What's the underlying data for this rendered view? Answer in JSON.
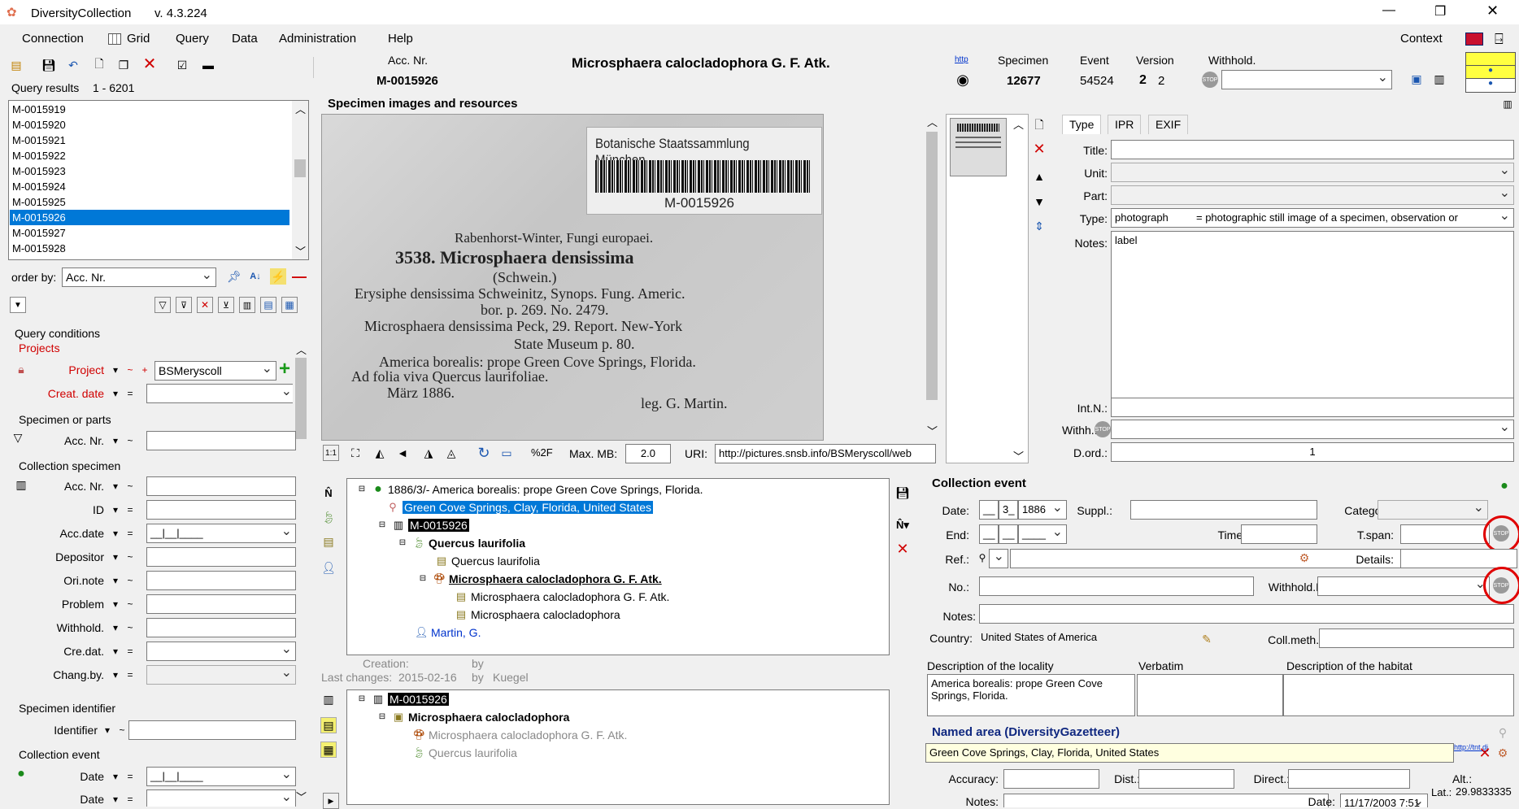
{
  "app": {
    "title": "DiversityCollection",
    "version": "v. 4.3.224"
  },
  "window_controls": {
    "minimize": "—",
    "restore": "❐",
    "close": "✕"
  },
  "menu": [
    "Connection",
    "Grid",
    "Query",
    "Data",
    "Administration",
    "Help"
  ],
  "context_label": "Context",
  "header": {
    "acc_nr_label": "Acc. Nr.",
    "acc_nr_value": "M-0015926",
    "taxon_title": "Microsphaera calocladophora G. F. Atk.",
    "http_label": "http",
    "specimen_label": "Specimen",
    "specimen_value": "12677",
    "event_label": "Event",
    "event_value": "54524",
    "version_label": "Version",
    "version_value_a": "2",
    "version_value_b": "2",
    "withhold_label": "Withhold."
  },
  "query_results": {
    "label": "Query results",
    "range": "1 - 6201",
    "items": [
      "M-0015919",
      "M-0015920",
      "M-0015921",
      "M-0015922",
      "M-0015923",
      "M-0015924",
      "M-0015925",
      "M-0015926",
      "M-0015927",
      "M-0015928"
    ],
    "selected_index": 7
  },
  "order_by": {
    "label": "order by:",
    "value": "Acc. Nr."
  },
  "query_conditions": {
    "title": "Query conditions",
    "projects_title": "Projects",
    "project_label": "Project",
    "project_value": "BSMeryscoll",
    "creat_date_label": "Creat. date",
    "specimen_parts_title": "Specimen or parts",
    "sp_acc_nr_label": "Acc. Nr.",
    "collection_specimen_title": "Collection specimen",
    "cs_fields": [
      "Acc. Nr.",
      "ID",
      "Acc.date",
      "Depositor",
      "Ori.note",
      "Problem",
      "Withhold.",
      "Cre.dat.",
      "Chang.by."
    ],
    "specimen_identifier_title": "Specimen identifier",
    "identifier_label": "Identifier",
    "collection_event_title": "Collection event",
    "ce_fields": [
      "Date",
      "Date"
    ]
  },
  "images": {
    "title": "Specimen images and resources",
    "label_lines": {
      "institution": "Botanische Staatssammlung München",
      "barcode_text": "M-0015926",
      "series": "Rabenhorst-Winter, Fungi europaei.",
      "number_taxon": "3538. Microsphaera densissima",
      "author": "(Schwein.)",
      "line1": "Erysiphe densissima Schweinitz, Synops. Fung. Americ.",
      "line2": "bor. p. 269. No. 2479.",
      "line3": "Microsphaera densissima Peck, 29. Report. New-York",
      "line4": "State Museum p. 80.",
      "line5": "America borealis: prope Green Cove Springs, Florida.",
      "line6": "Ad folia viva Quercus laurifoliae.",
      "date": "März 1886.",
      "collector": "leg. G. Martin."
    },
    "toolbar": {
      "one_to_one": "1:1",
      "percent": "%2F",
      "max_mb_label": "Max. MB:",
      "max_mb_value": "2.0",
      "uri_label": "URI:",
      "uri_value": "http://pictures.snsb.info/BSMeryscoll/web"
    }
  },
  "image_props": {
    "tabs": [
      "Type",
      "IPR",
      "EXIF"
    ],
    "title_label": "Title:",
    "unit_label": "Unit:",
    "part_label": "Part:",
    "type_label": "Type:",
    "type_value": "photograph",
    "type_desc": "= photographic still image of a specimen, observation or",
    "notes_label": "Notes:",
    "notes_value": "label",
    "intn_label": "Int.N.:",
    "withh_label": "Withh.:",
    "dord_label": "D.ord.:",
    "dord_value": "1"
  },
  "tree": {
    "nodes": [
      "1886/3/- America borealis: prope Green Cove Springs, Florida.",
      "Green Cove Springs, Clay, Florida, United States",
      "M-0015926",
      "Quercus laurifolia",
      "Quercus laurifolia",
      "Microsphaera calocladophora G. F. Atk.",
      "Microsphaera calocladophora G. F. Atk.",
      "Microsphaera calocladophora",
      "Martin, G."
    ],
    "creation_label": "Creation:",
    "by_label": "by",
    "last_changes_label": "Last changes:",
    "last_changes_date": "2015-02-16",
    "last_changes_by": "Kuegel"
  },
  "tree2": {
    "nodes": [
      "M-0015926",
      "Microsphaera calocladophora",
      "Microsphaera calocladophora G. F. Atk.",
      "Quercus laurifolia"
    ]
  },
  "collection_event": {
    "title": "Collection event",
    "date_label": "Date:",
    "date_day": "__",
    "date_month": "3_",
    "date_year": "1886",
    "suppl_label": "Suppl.:",
    "category_label": "Category:",
    "end_label": "End:",
    "time_label": "Time:",
    "tspan_label": "T.span:",
    "ref_label": "Ref.:",
    "details_label": "Details:",
    "no_label": "No.:",
    "withhold_r_label": "Withhold.R.:",
    "notes_label": "Notes:",
    "country_label": "Country:",
    "country_value": "United States of America",
    "collmeth_label": "Coll.meth.:",
    "locality_desc_label": "Description of the locality",
    "verbatim_label": "Verbatim",
    "habitat_label": "Description of the habitat",
    "locality_desc_value": "America borealis: prope Green Cove Springs, Florida."
  },
  "named_area": {
    "title": "Named area (DiversityGazetteer)",
    "value": "Green Cove Springs, Clay, Florida, United States",
    "link": "http://tnt.di",
    "accuracy_label": "Accuracy:",
    "dist_label": "Dist.:",
    "direct_label": "Direct.:",
    "alt_label": "Alt.:",
    "lat_label": "Lat.:",
    "lat_value": "29.9833335",
    "notes_label": "Notes:",
    "date_label": "Date:",
    "date_value": "11/17/2003 7:51"
  },
  "colors": {
    "selection": "#0078d7",
    "accent_red": "#d00000",
    "highlight_circle": "#e00000",
    "link_blue": "#0033cc"
  }
}
